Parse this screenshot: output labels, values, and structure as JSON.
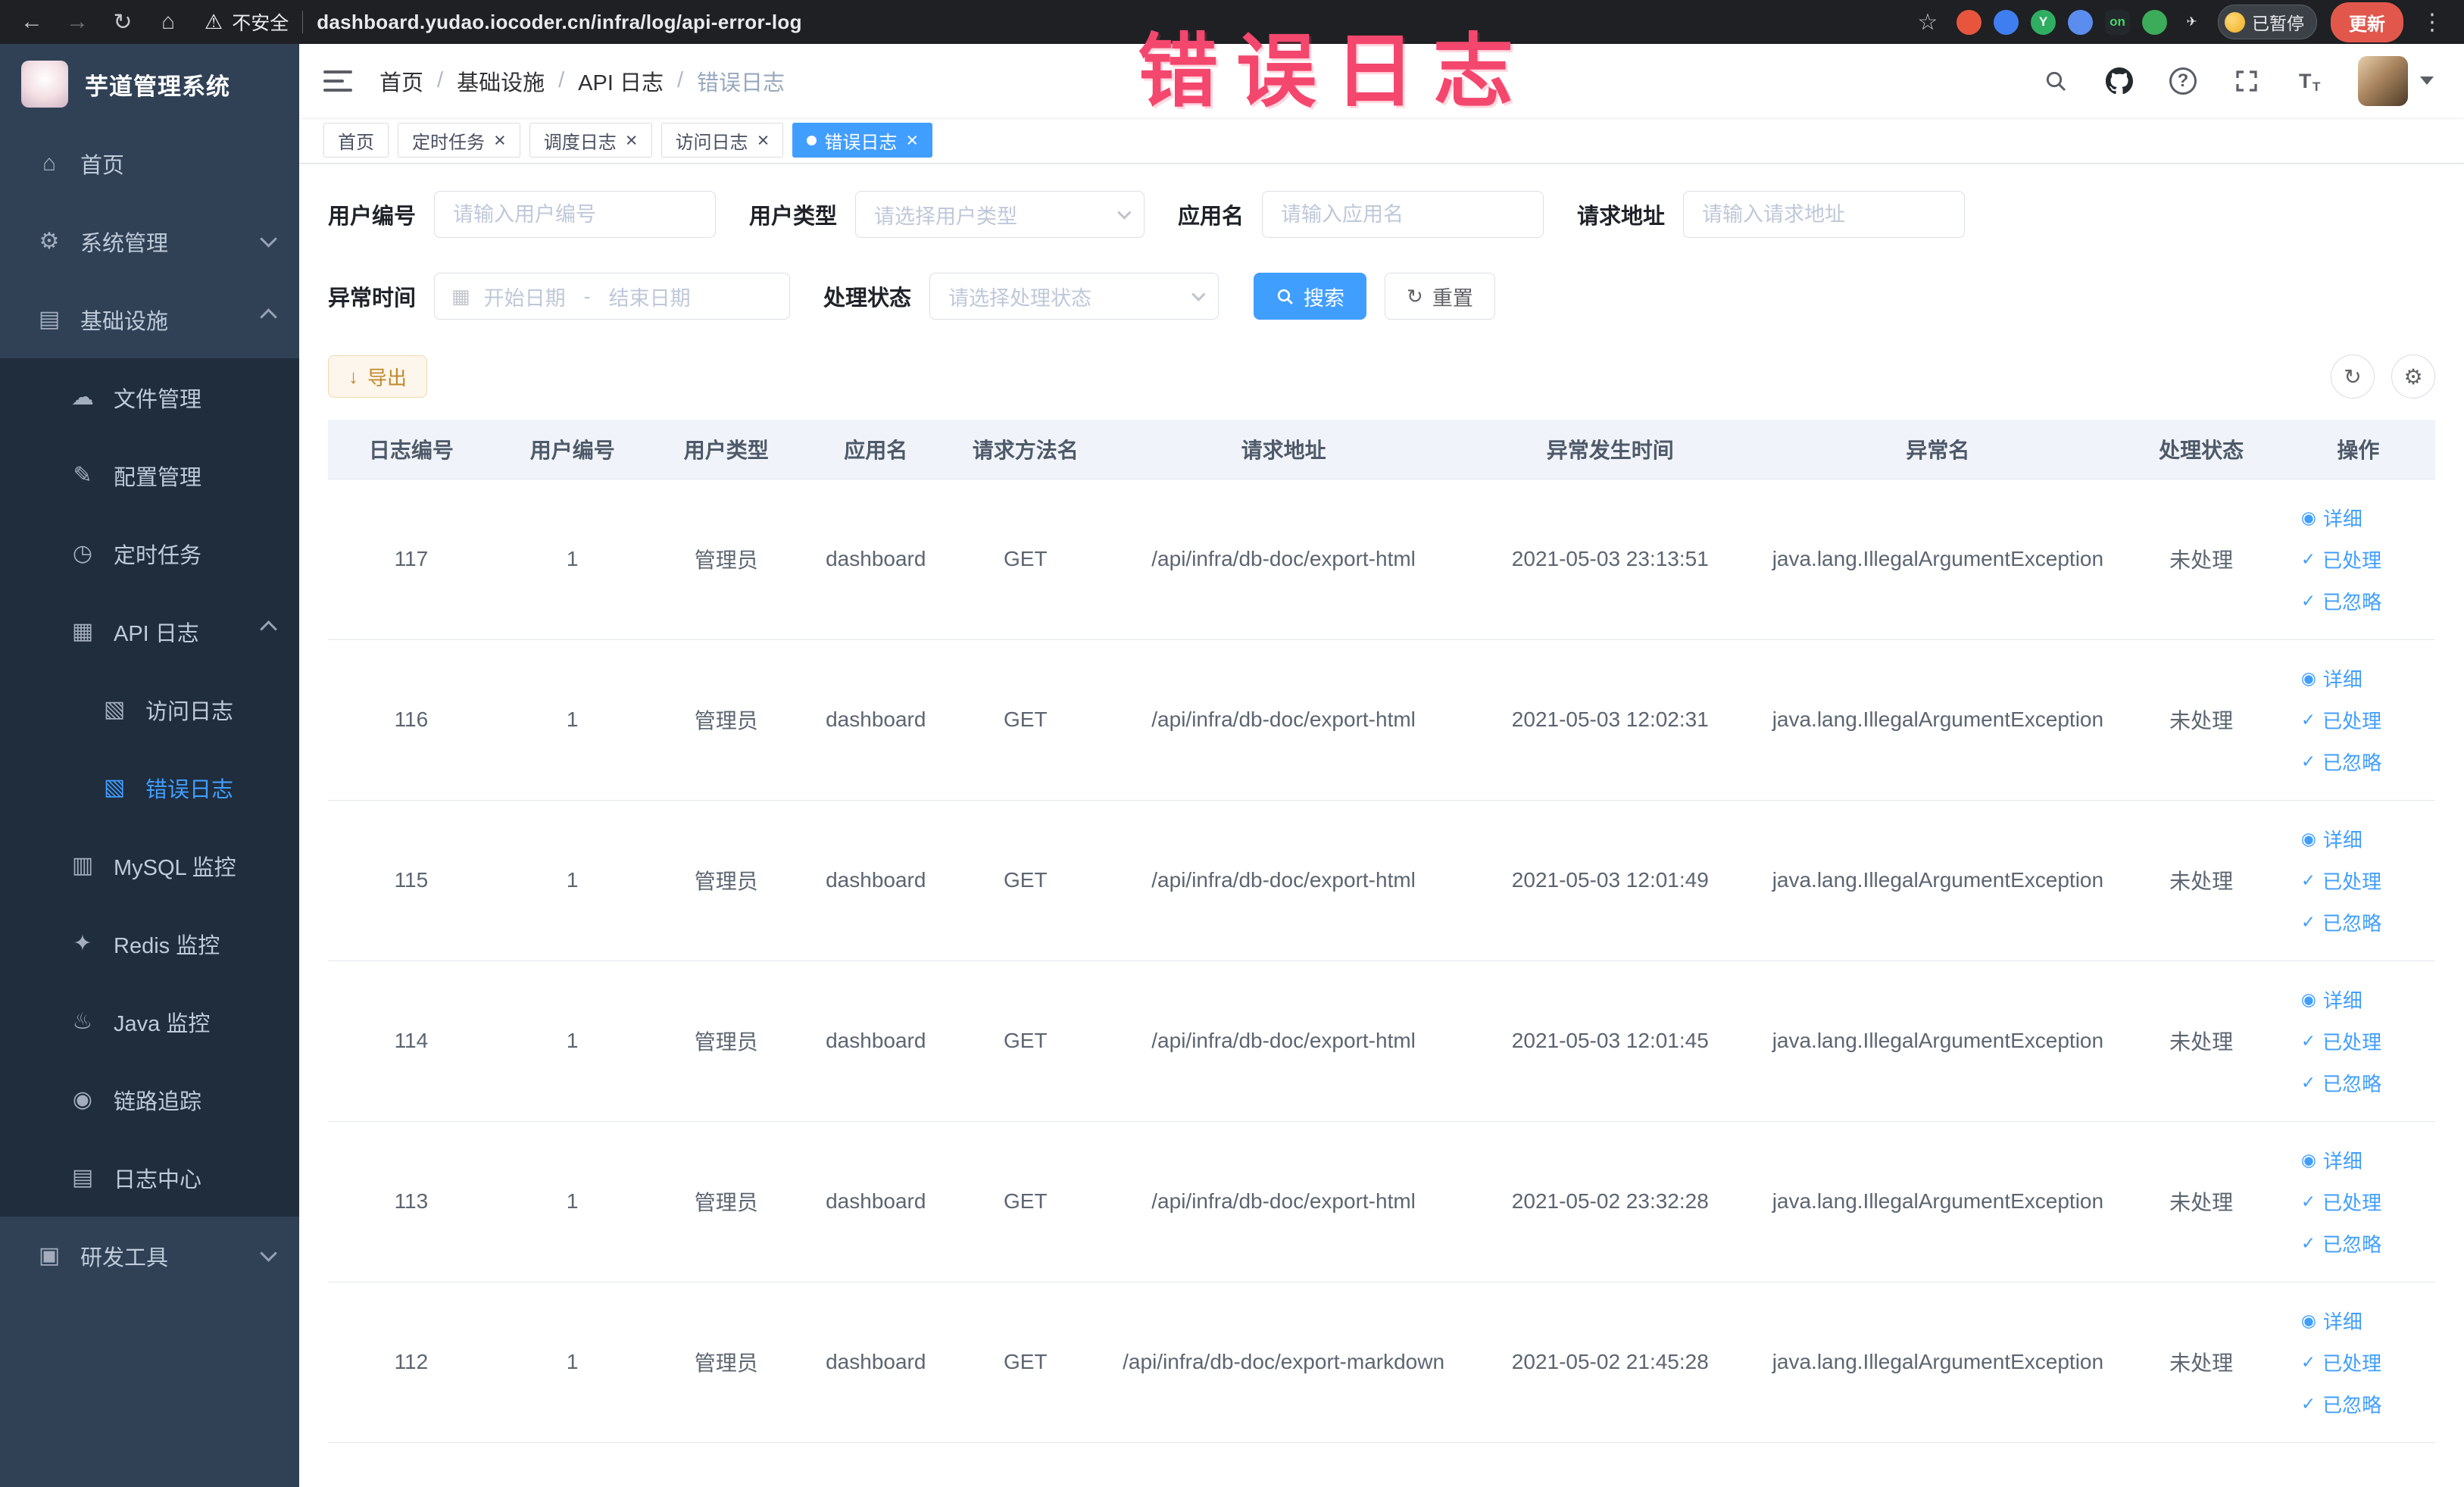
{
  "theme": {
    "primary": "#409eff",
    "sidebar_bg": "#304156",
    "submenu_bg": "#1f2d3d",
    "active_tab_bg": "#409eff",
    "warning_text": "#c08a2d",
    "watermark_color": "#f4476e",
    "browser_bar_bg": "#1e2023"
  },
  "watermark": {
    "text": "错误日志"
  },
  "browser": {
    "security_label": "不安全",
    "url": "dashboard.yudao.iocoder.cn/infra/log/api-error-log",
    "paused_badge": "已暂停",
    "update_label": "更新",
    "extensions": [
      {
        "name": "ext-red-circle-icon",
        "shape": "circle",
        "bg": "#e8553d",
        "fg": "#ffffff",
        "glyph": ""
      },
      {
        "name": "ext-blue-circle-icon",
        "shape": "circle",
        "bg": "#3f7ef0",
        "fg": "#ffffff",
        "glyph": ""
      },
      {
        "name": "ext-green-circle-icon",
        "shape": "circle",
        "bg": "#2fae62",
        "fg": "#ffffff",
        "glyph": "Y"
      },
      {
        "name": "ext-puzzle-icon",
        "shape": "circle",
        "bg": "#5b8def",
        "fg": "#ffffff",
        "glyph": ""
      },
      {
        "name": "ext-on-badge-icon",
        "shape": "square",
        "bg": "#23282d",
        "fg": "#47d764",
        "glyph": "on"
      },
      {
        "name": "ext-leaf-icon",
        "shape": "circle",
        "bg": "#3cab5a",
        "fg": "#ffffff",
        "glyph": ""
      },
      {
        "name": "ext-plane-icon",
        "shape": "none",
        "bg": "transparent",
        "fg": "#e8eaed",
        "glyph": "✈"
      }
    ]
  },
  "sidebar": {
    "logo_title": "芋道管理系统",
    "menu": [
      {
        "key": "home",
        "label": "首页",
        "icon": "home-icon",
        "level": 1
      },
      {
        "key": "system-mgmt",
        "label": "系统管理",
        "icon": "gear-icon",
        "level": 1,
        "chevron": "down"
      },
      {
        "key": "infrastructure",
        "label": "基础设施",
        "icon": "infra-icon",
        "level": 1,
        "chevron": "up"
      },
      {
        "key": "file-mgmt",
        "label": "文件管理",
        "icon": "file-icon",
        "level": 2,
        "sub": true
      },
      {
        "key": "config-mgmt",
        "label": "配置管理",
        "icon": "config-icon",
        "level": 2,
        "sub": true
      },
      {
        "key": "cron-job",
        "label": "定时任务",
        "icon": "timer-icon",
        "level": 2,
        "sub": true
      },
      {
        "key": "api-log",
        "label": "API 日志",
        "icon": "api-log-icon",
        "level": 2,
        "sub": true,
        "chevron": "up"
      },
      {
        "key": "access-log",
        "label": "访问日志",
        "icon": "doc-icon",
        "level": 3,
        "sub": true
      },
      {
        "key": "error-log",
        "label": "错误日志",
        "icon": "doc-icon",
        "level": 3,
        "sub": true,
        "active": true
      },
      {
        "key": "mysql-monitor",
        "label": "MySQL 监控",
        "icon": "mysql-icon",
        "level": 2,
        "sub": true
      },
      {
        "key": "redis-monitor",
        "label": "Redis 监控",
        "icon": "redis-icon",
        "level": 2,
        "sub": true
      },
      {
        "key": "java-monitor",
        "label": "Java 监控",
        "icon": "java-icon",
        "level": 2,
        "sub": true
      },
      {
        "key": "trace",
        "label": "链路追踪",
        "icon": "trace-icon",
        "level": 2,
        "sub": true
      },
      {
        "key": "log-center",
        "label": "日志中心",
        "icon": "log-center-icon",
        "level": 2,
        "sub": true
      },
      {
        "key": "dev-tools",
        "label": "研发工具",
        "icon": "tools-icon",
        "level": 1,
        "chevron": "down"
      }
    ]
  },
  "header": {
    "breadcrumb": [
      "首页",
      "基础设施",
      "API 日志",
      "错误日志"
    ]
  },
  "tags_view": [
    {
      "key": "home",
      "label": "首页",
      "closable": false,
      "active": false
    },
    {
      "key": "cron-job",
      "label": "定时任务",
      "closable": true,
      "active": false
    },
    {
      "key": "schedule-log",
      "label": "调度日志",
      "closable": true,
      "active": false
    },
    {
      "key": "access-log",
      "label": "访问日志",
      "closable": true,
      "active": false
    },
    {
      "key": "error-log",
      "label": "错误日志",
      "closable": true,
      "active": true
    }
  ],
  "filters": {
    "user_id": {
      "label": "用户编号",
      "placeholder": "请输入用户编号"
    },
    "user_type": {
      "label": "用户类型",
      "placeholder": "请选择用户类型"
    },
    "app_name": {
      "label": "应用名",
      "placeholder": "请输入应用名"
    },
    "request_url": {
      "label": "请求地址",
      "placeholder": "请输入请求地址"
    },
    "exception_time": {
      "label": "异常时间",
      "start_placeholder": "开始日期",
      "separator": "-",
      "end_placeholder": "结束日期"
    },
    "process_status": {
      "label": "处理状态",
      "placeholder": "请选择处理状态"
    },
    "search_button": "搜索",
    "reset_button": "重置"
  },
  "toolbar": {
    "export_label": "导出"
  },
  "table": {
    "headers": [
      "日志编号",
      "用户编号",
      "用户类型",
      "应用名",
      "请求方法名",
      "请求地址",
      "异常发生时间",
      "异常名",
      "处理状态",
      "操作"
    ],
    "rows": [
      [
        "117",
        "1",
        "管理员",
        "dashboard",
        "GET",
        "/api/infra/db-doc/export-html",
        "2021-05-03 23:13:51",
        "java.lang.IllegalArgumentException",
        "未处理"
      ],
      [
        "116",
        "1",
        "管理员",
        "dashboard",
        "GET",
        "/api/infra/db-doc/export-html",
        "2021-05-03 12:02:31",
        "java.lang.IllegalArgumentException",
        "未处理"
      ],
      [
        "115",
        "1",
        "管理员",
        "dashboard",
        "GET",
        "/api/infra/db-doc/export-html",
        "2021-05-03 12:01:49",
        "java.lang.IllegalArgumentException",
        "未处理"
      ],
      [
        "114",
        "1",
        "管理员",
        "dashboard",
        "GET",
        "/api/infra/db-doc/export-html",
        "2021-05-03 12:01:45",
        "java.lang.IllegalArgumentException",
        "未处理"
      ],
      [
        "113",
        "1",
        "管理员",
        "dashboard",
        "GET",
        "/api/infra/db-doc/export-html",
        "2021-05-02 23:32:28",
        "java.lang.IllegalArgumentException",
        "未处理"
      ],
      [
        "112",
        "1",
        "管理员",
        "dashboard",
        "GET",
        "/api/infra/db-doc/export-markdown",
        "2021-05-02 21:45:28",
        "java.lang.IllegalArgumentException",
        "未处理"
      ]
    ],
    "row_actions": [
      {
        "key": "detail",
        "label": "详细",
        "icon": "view-icon"
      },
      {
        "key": "processed",
        "label": "已处理",
        "icon": "check-icon"
      },
      {
        "key": "ignored",
        "label": "已忽略",
        "icon": "check-icon"
      }
    ]
  },
  "icon_glyphs": {
    "home-icon": "⌂",
    "gear-icon": "⚙",
    "infra-icon": "▤",
    "file-icon": "☁",
    "config-icon": "✎",
    "timer-icon": "◷",
    "api-log-icon": "▦",
    "doc-icon": "▧",
    "mysql-icon": "▥",
    "redis-icon": "✦",
    "java-icon": "♨",
    "trace-icon": "◉",
    "log-center-icon": "▤",
    "tools-icon": "▣",
    "view-icon": "◉",
    "check-icon": "✓",
    "calendar-icon": "▦",
    "download-icon": "↓",
    "refresh-icon": "↻",
    "settings-icon": "⚙"
  }
}
